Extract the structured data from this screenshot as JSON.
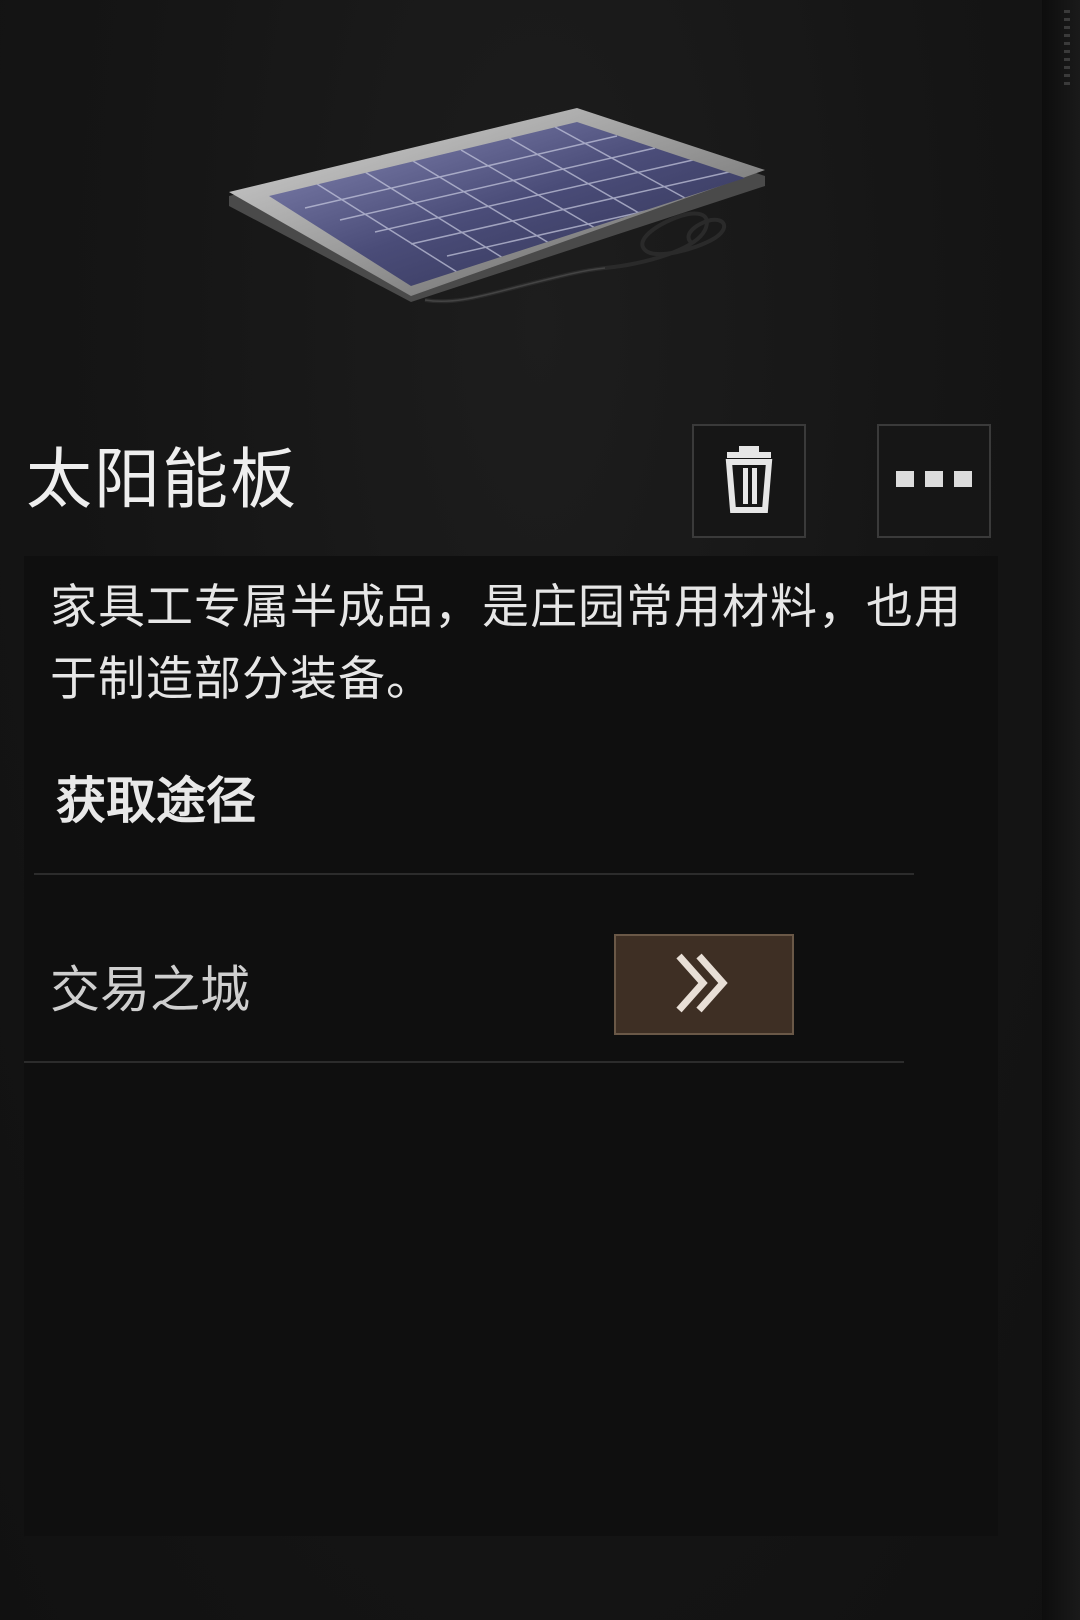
{
  "item": {
    "name": "太阳能板",
    "description": "家具工专属半成品，是庄园常用材料，也用于制造部分装备。",
    "image_icon": "solar-panel-icon"
  },
  "actions": {
    "delete_icon": "trash-icon",
    "more_icon": "more-dots-icon"
  },
  "acquire": {
    "section_title": "获取途径",
    "sources": [
      {
        "label": "交易之城",
        "action_icon": "double-chevron-right-icon"
      }
    ]
  },
  "colors": {
    "background": "#161616",
    "panel": "#0f0f0f",
    "text_primary": "#eeeeee",
    "button_accent": "#3e2f24",
    "button_border": "#6a5847"
  }
}
